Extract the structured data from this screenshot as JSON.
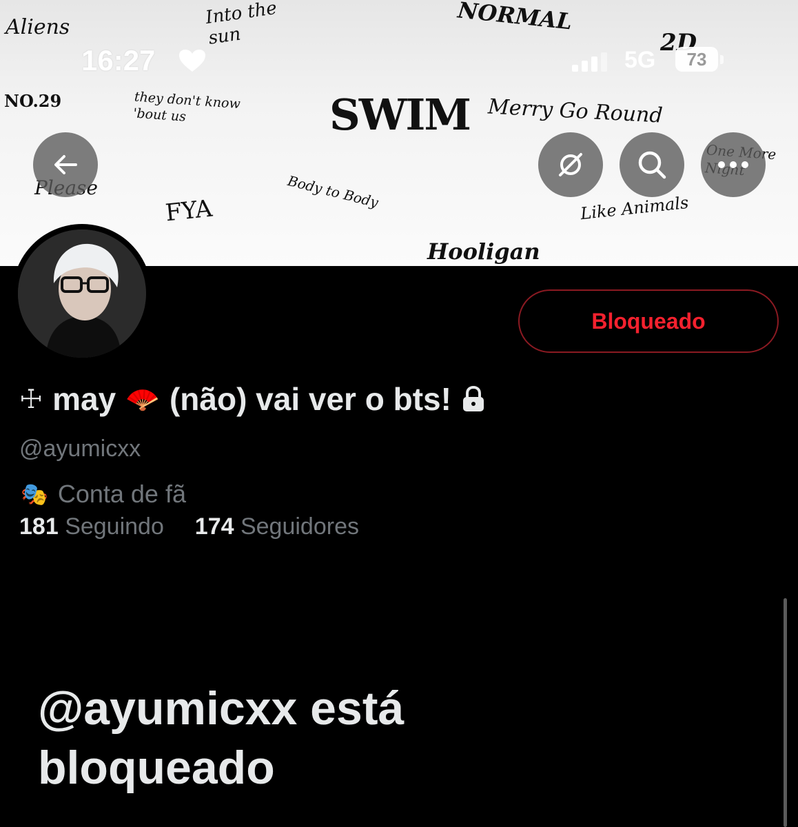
{
  "status_bar": {
    "time": "16:27",
    "network": "5G",
    "battery": "73"
  },
  "banner": {
    "songs": [
      "Aliens",
      "Into the sun",
      "NORMAL",
      "2D",
      "NO.29",
      "they don't know 'bout us",
      "SWIM",
      "Merry Go Round",
      "One More Night",
      "Please",
      "FYA",
      "Body to Body",
      "Like Animals",
      "Hooligan"
    ]
  },
  "profile": {
    "cross_symbol": "☩",
    "name_part1": "may",
    "fan_emoji": "🪭",
    "name_part2": "(não) vai ver o bts!",
    "handle": "@ayumicxx",
    "category_emoji": "🎭",
    "category": "Conta de fã",
    "following_count": "181",
    "following_label": "Seguindo",
    "followers_count": "174",
    "followers_label": "Seguidores",
    "blocked_button": "Bloqueado"
  },
  "blocked_message": "@ayumicxx está bloqueado",
  "colors": {
    "accent_red": "#f4212e",
    "muted": "#71767b",
    "text": "#e7e9ea",
    "background": "#000000"
  }
}
